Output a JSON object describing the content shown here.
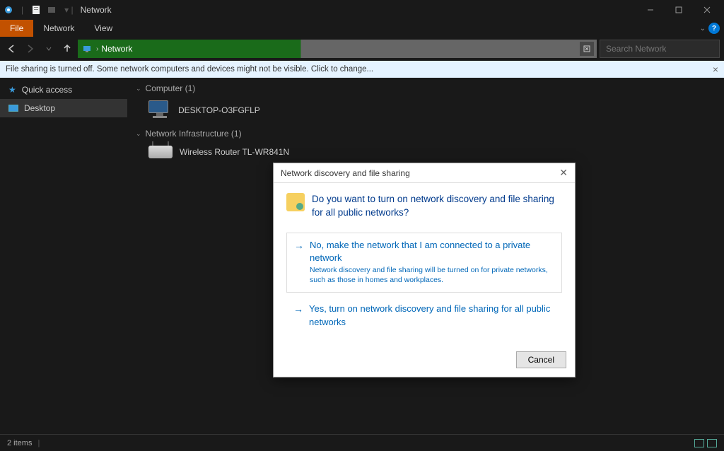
{
  "titlebar": {
    "title": "Network"
  },
  "ribbon": {
    "file": "File",
    "network": "Network",
    "view": "View"
  },
  "nav": {
    "breadcrumb": "Network",
    "search_placeholder": "Search Network"
  },
  "infobar": {
    "message": "File sharing is turned off. Some network computers and devices might not be visible. Click to change..."
  },
  "sidebar": {
    "quick_access": "Quick access",
    "desktop": "Desktop"
  },
  "content": {
    "group_computer": "Computer (1)",
    "computer_name": "DESKTOP-O3FGFLP",
    "group_infra": "Network Infrastructure (1)",
    "router_name": "Wireless Router TL-WR841N"
  },
  "dialog": {
    "title": "Network discovery and file sharing",
    "question": "Do you want to turn on network discovery and file sharing for all public networks?",
    "opt1_title": "No, make the network that I am connected to a private network",
    "opt1_desc": "Network discovery and file sharing will be turned on for private networks, such as those in homes and workplaces.",
    "opt2_title": "Yes, turn on network discovery and file sharing for all public networks",
    "cancel": "Cancel"
  },
  "statusbar": {
    "items": "2 items"
  }
}
